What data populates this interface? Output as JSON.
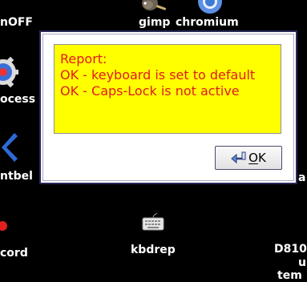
{
  "desktop": {
    "labels": {
      "top_left": "nOFF",
      "gimp": "gimp",
      "chromium": "chromium",
      "process": "ocess",
      "ntbel": "ntbel",
      "record": "cord",
      "kbdrep": "kbdrep",
      "d810": "D810",
      "u": "u",
      "tem": "tem"
    },
    "icons": [
      "gimp-icon",
      "chromium-icon",
      "process-gear-icon",
      "ntbel-icon",
      "record-icon",
      "keyboard-icon"
    ]
  },
  "dialog": {
    "report_lines": [
      "Report:",
      "OK - keyboard is set to default",
      "OK - Caps-Lock is not active"
    ],
    "ok_button": {
      "mnemonic": "O",
      "rest": "K",
      "icon": "return-arrow-icon"
    },
    "colors": {
      "report_background": "#ffff00",
      "report_text": "#e11b1b",
      "dialog_border": "#2a2a5c"
    }
  }
}
